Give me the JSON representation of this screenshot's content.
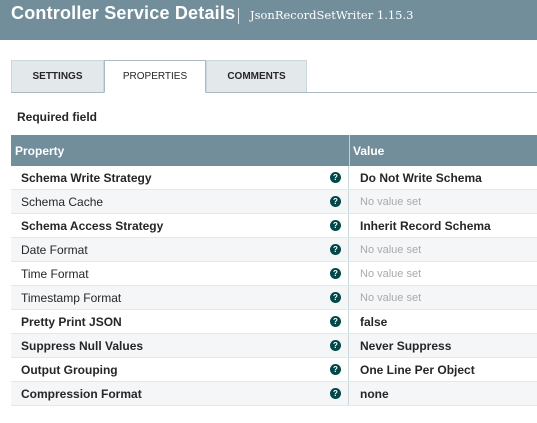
{
  "header": {
    "title": "Controller Service Details",
    "subtitle": "JsonRecordSetWriter 1.15.3"
  },
  "tabs": [
    {
      "label": "SETTINGS",
      "active": false
    },
    {
      "label": "PROPERTIES",
      "active": true
    },
    {
      "label": "COMMENTS",
      "active": false
    }
  ],
  "required_label": "Required field",
  "table": {
    "headers": {
      "property": "Property",
      "value": "Value"
    },
    "help_glyph": "?",
    "rows": [
      {
        "name": "Schema Write Strategy",
        "value": "Do Not Write Schema",
        "required": true,
        "set": true
      },
      {
        "name": "Schema Cache",
        "value": "No value set",
        "required": false,
        "set": false
      },
      {
        "name": "Schema Access Strategy",
        "value": "Inherit Record Schema",
        "required": true,
        "set": true
      },
      {
        "name": "Date Format",
        "value": "No value set",
        "required": false,
        "set": false
      },
      {
        "name": "Time Format",
        "value": "No value set",
        "required": false,
        "set": false
      },
      {
        "name": "Timestamp Format",
        "value": "No value set",
        "required": false,
        "set": false
      },
      {
        "name": "Pretty Print JSON",
        "value": "false",
        "required": true,
        "set": true
      },
      {
        "name": "Suppress Null Values",
        "value": "Never Suppress",
        "required": true,
        "set": true
      },
      {
        "name": "Output Grouping",
        "value": "One Line Per Object",
        "required": true,
        "set": true
      },
      {
        "name": "Compression Format",
        "value": "none",
        "required": true,
        "set": true
      }
    ]
  },
  "colors": {
    "header_bg": "#728e9b",
    "help_icon": "#004849",
    "tab_bg": "#e3e8eb"
  },
  "icons": {
    "help": "question-circle-icon"
  }
}
